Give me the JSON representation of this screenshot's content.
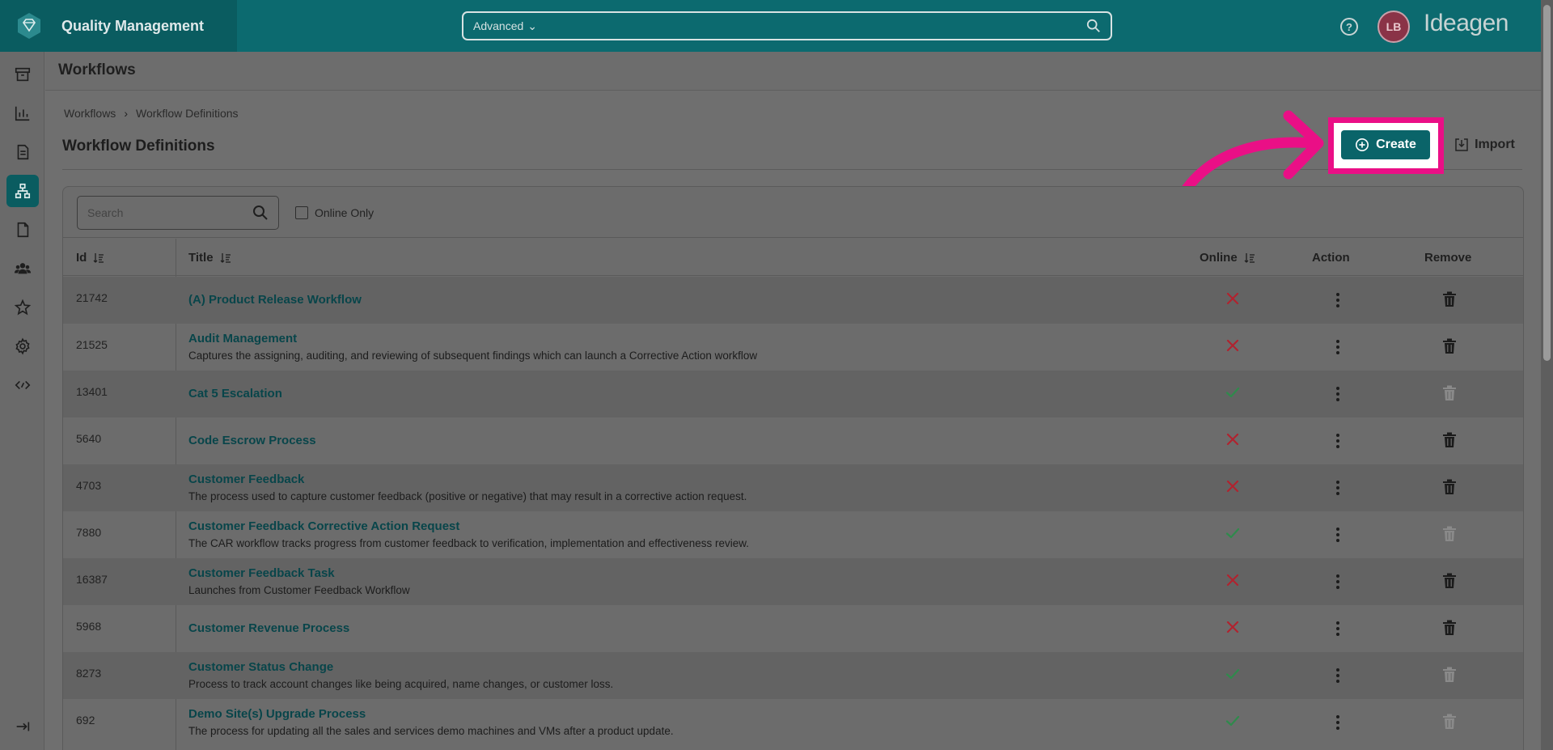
{
  "app": {
    "brand_name": "Quality Management",
    "company_logo": "Ideagen",
    "search_mode": "Advanced",
    "help_glyph": "?",
    "user_initials": "LB"
  },
  "sidebar": {
    "items": [
      {
        "icon": "archive-icon"
      },
      {
        "icon": "chart-icon"
      },
      {
        "icon": "document-icon"
      },
      {
        "icon": "workflow-icon",
        "active": true
      },
      {
        "icon": "file-icon"
      },
      {
        "icon": "users-icon"
      },
      {
        "icon": "star-icon"
      },
      {
        "icon": "gear-icon"
      },
      {
        "icon": "code-icon"
      }
    ],
    "collapse_icon": "expand-sidebar-icon"
  },
  "page": {
    "header_title": "Workflows",
    "breadcrumb": [
      "Workflows",
      "Workflow Definitions"
    ],
    "section_title": "Workflow Definitions",
    "create_label": "Create",
    "import_label": "Import"
  },
  "filters": {
    "search_placeholder": "Search",
    "online_only_label": "Online Only",
    "online_only_checked": false
  },
  "table": {
    "columns": {
      "id": "Id",
      "title": "Title",
      "online": "Online",
      "action": "Action",
      "remove": "Remove"
    },
    "rows": [
      {
        "id": "21742",
        "title": "(A) Product Release Workflow",
        "description": "",
        "online": false,
        "removable": true
      },
      {
        "id": "21525",
        "title": "Audit Management",
        "description": "Captures the assigning, auditing, and reviewing of subsequent findings which can launch a Corrective Action workflow",
        "online": false,
        "removable": true
      },
      {
        "id": "13401",
        "title": "Cat 5 Escalation",
        "description": "",
        "online": true,
        "removable": false
      },
      {
        "id": "5640",
        "title": "Code Escrow Process",
        "description": "",
        "online": false,
        "removable": true
      },
      {
        "id": "4703",
        "title": "Customer Feedback",
        "description": "The process used to capture customer feedback (positive or negative) that may result in a corrective action request.",
        "online": false,
        "removable": true
      },
      {
        "id": "7880",
        "title": "Customer Feedback Corrective Action Request",
        "description": "The CAR workflow tracks progress from customer feedback to verification, implementation and effectiveness review.",
        "online": true,
        "removable": false
      },
      {
        "id": "16387",
        "title": "Customer Feedback Task",
        "description": "Launches from Customer Feedback Workflow",
        "online": false,
        "removable": true
      },
      {
        "id": "5968",
        "title": "Customer Revenue Process",
        "description": "",
        "online": false,
        "removable": true
      },
      {
        "id": "8273",
        "title": "Customer Status Change",
        "description": "Process to track account changes like being acquired, name changes, or customer loss.",
        "online": true,
        "removable": false
      },
      {
        "id": "692",
        "title": "Demo Site(s) Upgrade Process",
        "description": "The process for updating all the sales and services demo machines and VMs after a product update.",
        "online": true,
        "removable": false
      }
    ]
  },
  "colors": {
    "brand_teal": "#0c6a6f",
    "highlight_pink": "#ea0f86",
    "offline_red": "#b0232f",
    "online_green": "#2f8a4c"
  }
}
